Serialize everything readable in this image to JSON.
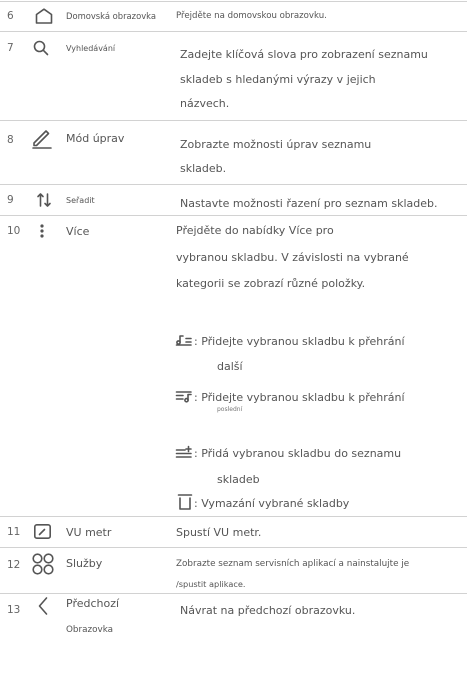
{
  "rows": [
    {
      "number": "6",
      "icon": "home-icon",
      "label": "Domovská obrazovka",
      "description": [
        "Přejděte na domovskou obrazovku."
      ]
    },
    {
      "number": "7",
      "icon": "search-icon",
      "label": "Vyhledávání",
      "description": [
        "Zadejte klíčová slova pro zobrazení seznamu",
        "skladeb s hledanými výrazy v jejich",
        "názvech."
      ]
    },
    {
      "number": "8",
      "icon": "edit-icon",
      "label": "Mód úprav",
      "description": [
        "Zobrazte možnosti úprav seznamu",
        "skladeb."
      ]
    },
    {
      "number": "9",
      "icon": "sort-icon",
      "label": "Seřadit",
      "description": [
        "Nastavte možnosti řazení pro seznam skladeb."
      ]
    },
    {
      "number": "10",
      "icon": "more-icon",
      "label": "Více",
      "description": [
        "Přejděte do nabídky Více pro",
        "vybranou skladbu. V závislosti na vybrané",
        "kategorii se zobrazí různé položky."
      ],
      "sub_items": [
        {
          "icon": "play-next-icon",
          "text": ": Přidejte vybranou skladbu k přehrání",
          "continuation": "další"
        },
        {
          "icon": "play-last-icon",
          "text": ": Přidejte vybranou skladbu k přehrání",
          "continuation": "poslední"
        },
        {
          "icon": "add-to-playlist-icon",
          "text": ": Přidá vybranou skladbu do seznamu",
          "continuation": "skladeb"
        },
        {
          "icon": "delete-icon",
          "text": ": Vymazání vybrané skladby"
        }
      ]
    },
    {
      "number": "11",
      "icon": "vu-meter-icon",
      "label": "VU metr",
      "description": [
        "Spustí VU metr."
      ]
    },
    {
      "number": "12",
      "icon": "services-icon",
      "label": "Služby",
      "description": [
        "Zobrazte seznam servisních aplikací a nainstalujte je",
        "/spustit aplikace."
      ]
    },
    {
      "number": "13",
      "icon": "back-icon",
      "label": "Předchozí",
      "label_continuation": "Obrazovka",
      "description": [
        "Návrat na předchozí obrazovku."
      ]
    }
  ]
}
